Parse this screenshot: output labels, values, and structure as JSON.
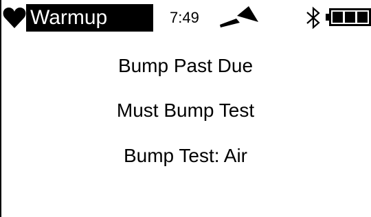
{
  "status": {
    "mode_label": "Warmup",
    "time": "7:49",
    "icons": [
      "heart-icon",
      "signal-icon",
      "bluetooth-icon",
      "battery-icon"
    ],
    "battery_level": 1.0
  },
  "messages": [
    "Bump Past Due",
    "Must Bump Test",
    "Bump Test: Air"
  ]
}
